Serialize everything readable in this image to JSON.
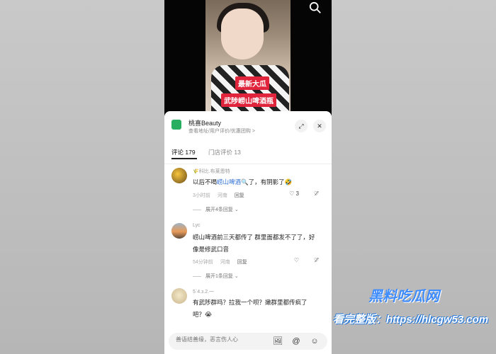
{
  "video": {
    "sticker_top": "最新大瓜",
    "sticker_bottom": "武陟崂山啤酒瓶"
  },
  "shop": {
    "name": "桃喜Beauty",
    "subtitle": "查看地址/用户评价/优惠团购 >"
  },
  "tabs": [
    {
      "label": "评论 179"
    },
    {
      "label": "门店评价 13"
    }
  ],
  "comments": [
    {
      "user": "🌾科比.布莱恩特",
      "text_pre": "以后不喝",
      "text_hl": "崂山啤酒🔍",
      "text_post": "了，有阴影了🤣",
      "time": "3小时前",
      "location": "河南",
      "reply": "回复",
      "likes": "3",
      "expand": "展开4条回复 ⌄"
    },
    {
      "user": "Lyc",
      "text": "崂山啤酒前三天都传了 群里面都发不了了，好像是修武口音",
      "time": "54分钟前",
      "location": "河南",
      "reply": "回复",
      "likes": "",
      "expand": "展开1条回复 ⌄"
    },
    {
      "user": "5`4.з.2.一",
      "text": "有武陟群吗？拉我一个呗？嫩群里都传疯了吧？😭",
      "time": "",
      "location": "",
      "reply": "",
      "likes": ""
    }
  ],
  "input": {
    "placeholder": "善语结善缘，恶言伤人心"
  },
  "watermark": {
    "line1": "黑料吃瓜网",
    "line2": "看完整版：https://hlcgw53.com"
  }
}
